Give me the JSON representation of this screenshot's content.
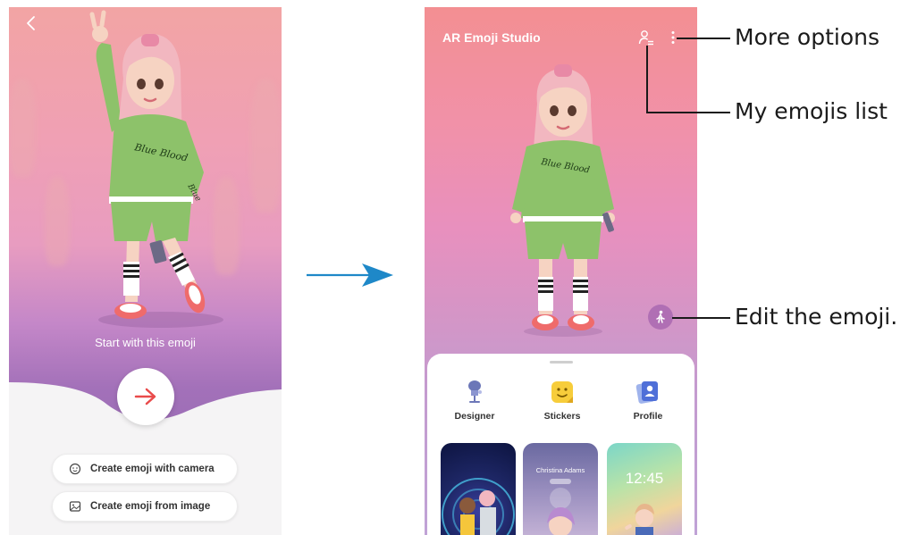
{
  "left_screen": {
    "start_text": "Start with this emoji",
    "buttons": [
      {
        "label": "Create emoji with camera",
        "icon": "face-icon"
      },
      {
        "label": "Create emoji from image",
        "icon": "image-icon"
      }
    ]
  },
  "right_screen": {
    "title": "AR Emoji Studio",
    "features": [
      {
        "label": "Designer",
        "icon": "designer-icon"
      },
      {
        "label": "Stickers",
        "icon": "stickers-icon"
      },
      {
        "label": "Profile",
        "icon": "profile-icon"
      }
    ],
    "thumbnails": {
      "contact_name": "Christina Adams",
      "lock_time": "12:45"
    }
  },
  "callouts": {
    "more_options": "More options",
    "my_emojis_list": "My emojis list",
    "edit_emoji": "Edit the emoji."
  },
  "colors": {
    "arrow": "#1e88c8",
    "go_arrow": "#e94b4b",
    "sweater": "#8dc26a",
    "hair": "#f2b7c0"
  }
}
